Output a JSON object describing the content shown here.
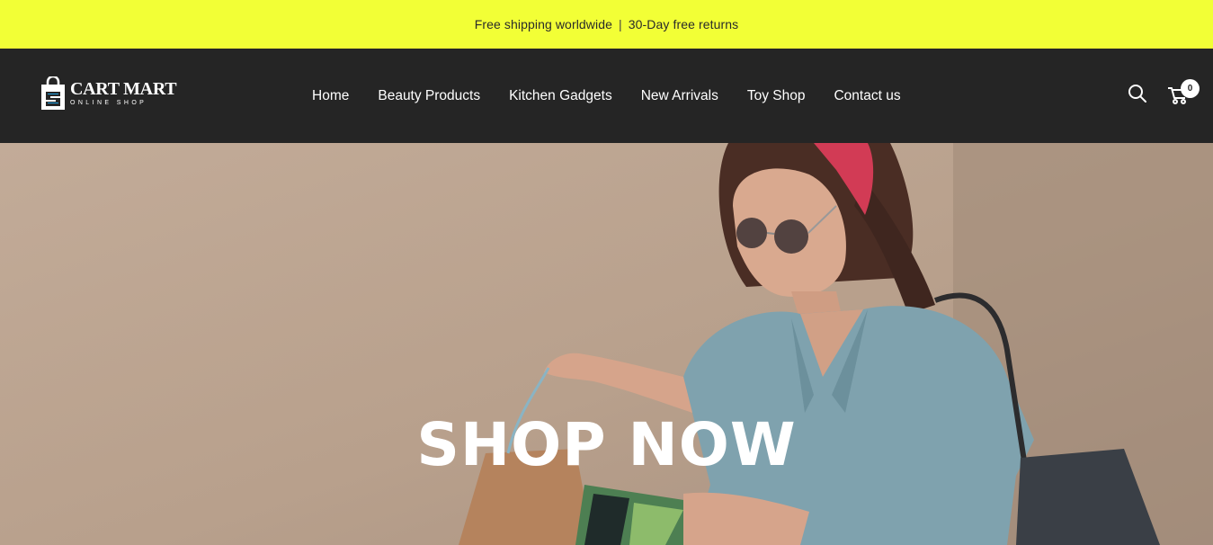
{
  "announcement": {
    "shipping": "Free shipping worldwide",
    "separator": "|",
    "returns": "30-Day free returns"
  },
  "brand": {
    "name": "CART MART",
    "tagline": "ONLINE SHOP",
    "logo_icon": "shopping-bag-s-icon"
  },
  "nav": {
    "items": [
      {
        "label": "Home"
      },
      {
        "label": "Beauty Products"
      },
      {
        "label": "Kitchen Gadgets"
      },
      {
        "label": "New Arrivals"
      },
      {
        "label": "Toy Shop"
      },
      {
        "label": "Contact us"
      }
    ]
  },
  "header_icons": {
    "search": "search-icon",
    "cart": "cart-icon",
    "cart_count": "0"
  },
  "hero": {
    "title": "SHOP NOW"
  },
  "colors": {
    "announcement_bg": "#f2ff36",
    "header_bg": "#252525",
    "hero_bg": "#b59f8c",
    "logo_accent": "#1fa0e0"
  }
}
